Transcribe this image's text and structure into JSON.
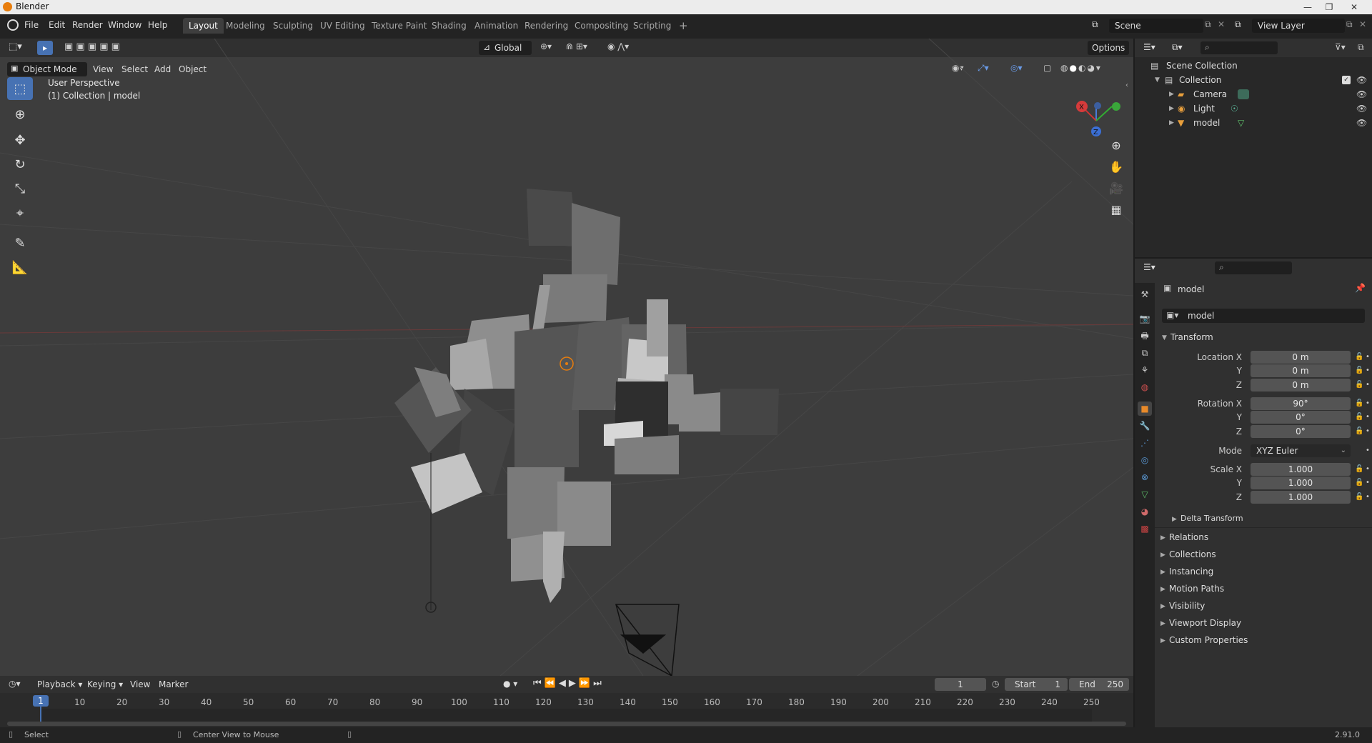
{
  "window": {
    "title": "Blender",
    "controls": [
      "—",
      "❐",
      "✕"
    ]
  },
  "menu": [
    "File",
    "Edit",
    "Render",
    "Window",
    "Help"
  ],
  "workspaces": [
    "Layout",
    "Modeling",
    "Sculpting",
    "UV Editing",
    "Texture Paint",
    "Shading",
    "Animation",
    "Rendering",
    "Compositing",
    "Scripting"
  ],
  "add_workspace": "+",
  "scene": {
    "label": "Scene",
    "view_layer": "View Layer"
  },
  "viewport": {
    "mode": "Object Mode",
    "header_menus": [
      "View",
      "Select",
      "Add",
      "Object"
    ],
    "transform_orientation": "Global",
    "options": "Options",
    "info_line1": "User Perspective",
    "info_line2": "(1) Collection | model",
    "gizmo": {
      "x": "X",
      "y": "Y",
      "z": "Z"
    }
  },
  "outliner": {
    "root": "Scene Collection",
    "collection": "Collection",
    "items": [
      {
        "name": "Camera",
        "icon": "camera-icon"
      },
      {
        "name": "Light",
        "icon": "light-icon"
      },
      {
        "name": "model",
        "icon": "mesh-icon"
      }
    ]
  },
  "properties": {
    "object_name": "model",
    "data_name": "model",
    "transform_title": "Transform",
    "location_label": "Location X",
    "location": [
      "0 m",
      "0 m",
      "0 m"
    ],
    "rotation_label": "Rotation X",
    "rotation": [
      "90°",
      "0°",
      "0°"
    ],
    "mode_label": "Mode",
    "mode_value": "XYZ Euler",
    "scale_label": "Scale X",
    "scale": [
      "1.000",
      "1.000",
      "1.000"
    ],
    "axis_y": "Y",
    "axis_z": "Z",
    "delta_transform": "Delta Transform",
    "panels": [
      "Relations",
      "Collections",
      "Instancing",
      "Motion Paths",
      "Visibility",
      "Viewport Display",
      "Custom Properties"
    ]
  },
  "timeline": {
    "menus": [
      "Playback",
      "Keying",
      "View",
      "Marker"
    ],
    "current_frame": "1",
    "start_label": "Start",
    "start": "1",
    "end_label": "End",
    "end": "250",
    "ruler": [
      "1",
      "10",
      "20",
      "30",
      "40",
      "50",
      "60",
      "70",
      "80",
      "90",
      "100",
      "110",
      "120",
      "130",
      "140",
      "150",
      "160",
      "170",
      "180",
      "190",
      "200",
      "210",
      "220",
      "230",
      "240",
      "250"
    ]
  },
  "status": {
    "left": "Select",
    "middle": "Center View to Mouse",
    "version": "2.91.0"
  },
  "colors": {
    "accent": "#4772b3",
    "background": "#3d3d3d",
    "object_origin": "#e87d0d"
  }
}
